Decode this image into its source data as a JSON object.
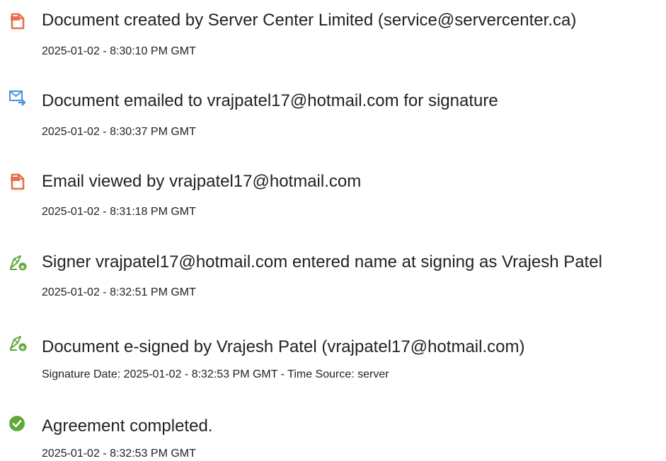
{
  "events": [
    {
      "icon": "document-created-icon",
      "title": "Document created by Server Center Limited (service@servercenter.ca)",
      "subtitle": "2025-01-02 - 8:30:10 PM GMT"
    },
    {
      "icon": "email-sent-icon",
      "title": "Document emailed to vrajpatel17@hotmail.com for signature",
      "subtitle": "2025-01-02 - 8:30:37 PM GMT"
    },
    {
      "icon": "document-viewed-icon",
      "title": "Email viewed by vrajpatel17@hotmail.com",
      "subtitle": "2025-01-02 - 8:31:18 PM GMT"
    },
    {
      "icon": "esign-pen-icon",
      "title": "Signer vrajpatel17@hotmail.com entered name at signing as Vrajesh Patel",
      "subtitle": "2025-01-02 - 8:32:51 PM GMT"
    },
    {
      "icon": "esign-pen-icon",
      "title": "Document e-signed by Vrajesh Patel (vrajpatel17@hotmail.com)",
      "subtitle": "Signature Date: 2025-01-02 - 8:32:53 PM GMT - Time Source: server"
    },
    {
      "icon": "check-circle-icon",
      "title": "Agreement completed.",
      "subtitle": "2025-01-02 - 8:32:53 PM GMT"
    }
  ],
  "colors": {
    "document_icon": "#e8704a",
    "email_icon": "#4a90e2",
    "esign_icon": "#5fa83a",
    "check_icon": "#5fa83a",
    "text": "#222222"
  }
}
